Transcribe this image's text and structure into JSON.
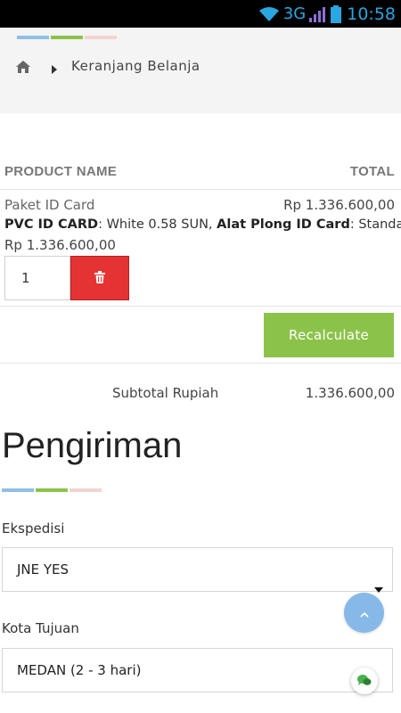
{
  "status_bar": {
    "network": "3G",
    "time": "10:58",
    "icons": [
      "wifi-icon",
      "signal-icon",
      "battery-icon"
    ]
  },
  "breadcrumb": {
    "home_icon": "home-icon",
    "separator_icon": "chevron-right-icon",
    "current": "Keranjang Belanja"
  },
  "cart": {
    "columns": {
      "product": "PRODUCT NAME",
      "total": "TOTAL"
    },
    "item": {
      "name": "Paket ID Card",
      "total": "Rp 1.336.600,00",
      "options": [
        {
          "label": "PVC ID CARD",
          "value": ": White 0.58 SUN, "
        },
        {
          "label": "Alat Plong ID Card",
          "value": ": Standart"
        }
      ],
      "price": "Rp 1.336.600,00",
      "quantity": "1",
      "delete_icon": "trash-icon"
    },
    "recalculate_label": "Recalculate",
    "subtotal_label": "Subtotal Rupiah",
    "subtotal_value": "1.336.600,00"
  },
  "shipping": {
    "title": "Pengiriman",
    "courier_label": "Ekspedisi",
    "courier_value": "JNE YES",
    "city_label": "Kota Tujuan",
    "city_value": "MEDAN (2 - 3 hari)"
  },
  "floating": {
    "scroll_top_icon": "chevron-up-icon",
    "chat_icon": "chat-icon"
  },
  "colors": {
    "accent_green": "#8bc34a",
    "delete_red": "#e53333",
    "stripe_blue": "#8fbfe6",
    "stripe_pink": "#f1d4d0",
    "fab_blue": "#86b9e8"
  }
}
